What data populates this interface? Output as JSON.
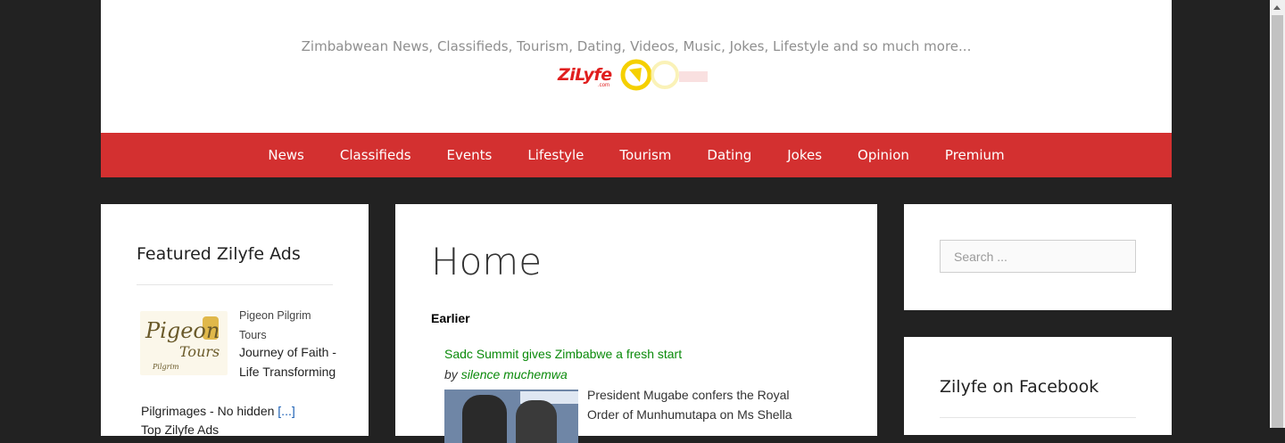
{
  "header": {
    "tagline": "Zimbabwean News, Classifieds, Tourism, Dating, Videos, Music, Jokes, Lifestyle and so much more...",
    "logo_text": "ZiLyfe",
    "logo_sub": ".com"
  },
  "nav": {
    "items": [
      {
        "label": "News"
      },
      {
        "label": "Classifieds"
      },
      {
        "label": "Events"
      },
      {
        "label": "Lifestyle"
      },
      {
        "label": "Tourism"
      },
      {
        "label": "Dating"
      },
      {
        "label": "Jokes"
      },
      {
        "label": "Opinion"
      },
      {
        "label": "Premium"
      }
    ]
  },
  "left_sidebar": {
    "title": "Featured Zilyfe Ads",
    "ad": {
      "image_text_1": "Pigeon",
      "image_text_2": "Tours",
      "image_text_3": "Pilgrim",
      "company": "Pigeon Pilgrim Tours",
      "desc_lines": "Journey of Faith - Life Transforming",
      "desc_cont": "Pilgrimages - No hidden",
      "more": "[...]",
      "next": "Top Zilyfe Ads"
    }
  },
  "main": {
    "title": "Home",
    "section": "Earlier",
    "article": {
      "title": "Sadc Summit gives Zimbabwe a fresh start",
      "by": "by",
      "author": "silence muchemwa",
      "excerpt": "President Mugabe confers the Royal Order of Munhumutapa on Ms Shella"
    }
  },
  "right_sidebar": {
    "search_placeholder": "Search ...",
    "facebook_title": "Zilyfe on Facebook"
  },
  "colors": {
    "nav_bg": "#d33030",
    "page_bg": "#222222",
    "link_green": "#0a8a0a"
  }
}
